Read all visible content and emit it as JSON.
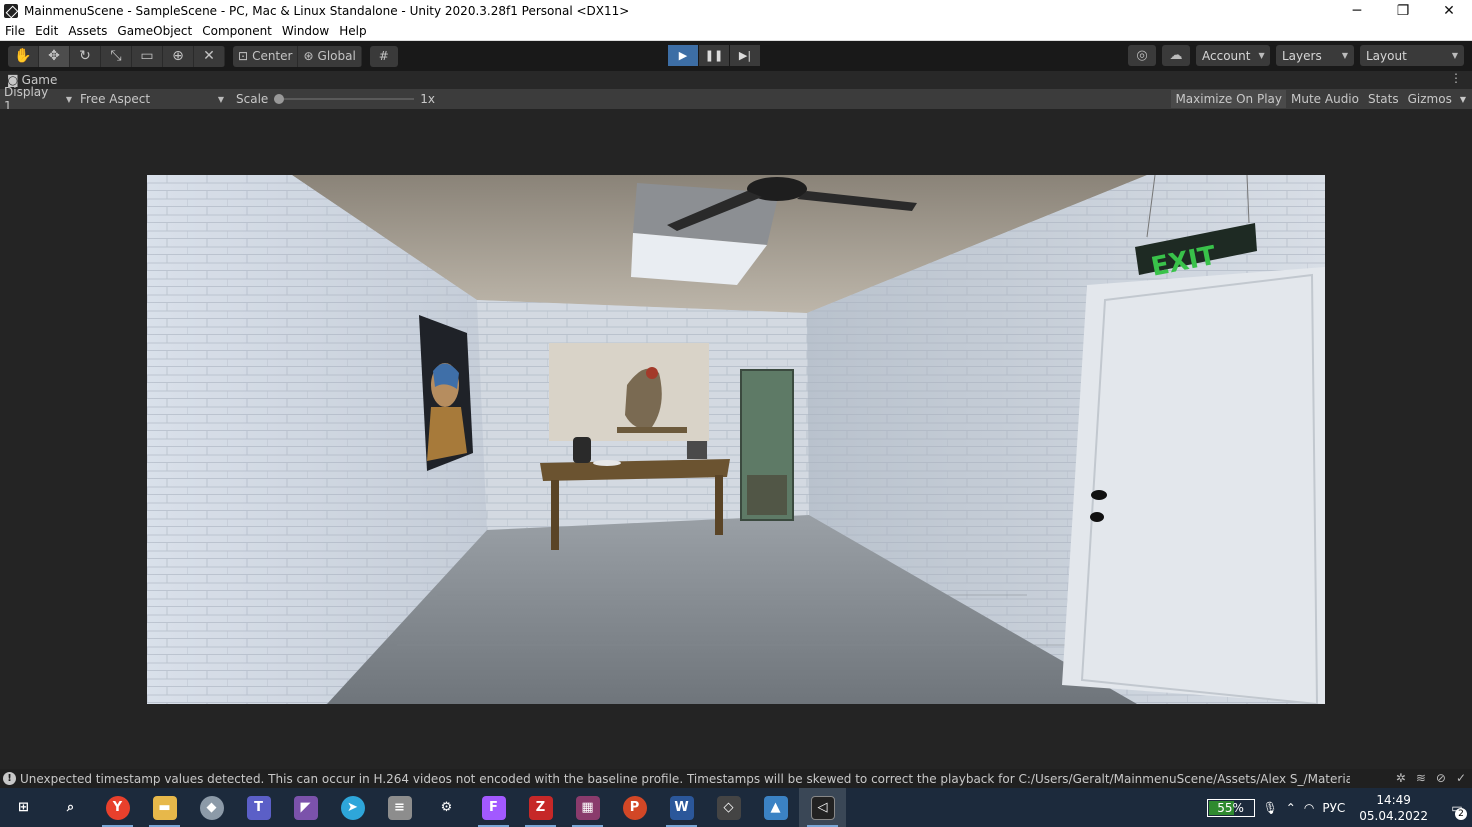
{
  "window": {
    "title": "MainmenuScene - SampleScene - PC, Mac & Linux Standalone - Unity 2020.3.28f1 Personal <DX11>",
    "minimize": "─",
    "restore": "❐",
    "close": "✕"
  },
  "menu": [
    "File",
    "Edit",
    "Assets",
    "GameObject",
    "Component",
    "Window",
    "Help"
  ],
  "toolbar": {
    "tools": [
      "hand-tool-icon",
      "move-tool-icon",
      "rotate-tool-icon",
      "scale-tool-icon",
      "rect-tool-icon",
      "transform-tool-icon",
      "custom-tool-icon"
    ],
    "pivot_center": "Center",
    "pivot_global": "Global",
    "account": "Account",
    "layers": "Layers",
    "layout": "Layout"
  },
  "game_tab": {
    "label": "Game"
  },
  "game_controls": {
    "display": "Display 1",
    "aspect": "Free Aspect",
    "scale_label": "Scale",
    "scale_value": "1x",
    "maximize_on_play": "Maximize On Play",
    "mute_audio": "Mute Audio",
    "stats": "Stats",
    "gizmos": "Gizmos"
  },
  "scene": {
    "exit_sign": "EXIT"
  },
  "status": {
    "message": "Unexpected timestamp values detected. This can occur in H.264 videos not encoded with the baseline profile. Timestamps will be skewed to correct the playback for C:/Users/Geralt/MainmenuScene/Assets/Alex S_/Materials/Cameras/Kam"
  },
  "taskbar": {
    "apps": [
      {
        "name": "start",
        "glyph": "⊞",
        "color": "#1c2a3c"
      },
      {
        "name": "search",
        "glyph": "⌕",
        "color": "#1c2a3c"
      },
      {
        "name": "yandex-browser",
        "glyph": "Y",
        "color": "#e8402c"
      },
      {
        "name": "file-explorer",
        "glyph": "▬",
        "color": "#e7b84a"
      },
      {
        "name": "security",
        "glyph": "◆",
        "color": "#8c9aa8"
      },
      {
        "name": "teams",
        "glyph": "T",
        "color": "#5b5fc7"
      },
      {
        "name": "visual-studio",
        "glyph": "◤",
        "color": "#7b52ab"
      },
      {
        "name": "telegram",
        "glyph": "➤",
        "color": "#2ea6da"
      },
      {
        "name": "database",
        "glyph": "≡",
        "color": "#8d8d8d"
      },
      {
        "name": "settings",
        "glyph": "⚙",
        "color": "#1c2a3c"
      },
      {
        "name": "figma",
        "glyph": "F",
        "color": "#a259ff"
      },
      {
        "name": "filezilla",
        "glyph": "Z",
        "color": "#c62828"
      },
      {
        "name": "winrar",
        "glyph": "▦",
        "color": "#8a3b6c"
      },
      {
        "name": "powerpoint",
        "glyph": "P",
        "color": "#d24726"
      },
      {
        "name": "word",
        "glyph": "W",
        "color": "#2b579a"
      },
      {
        "name": "unity-hub",
        "glyph": "◇",
        "color": "#444"
      },
      {
        "name": "photos",
        "glyph": "▲",
        "color": "#3b82c4"
      },
      {
        "name": "unity",
        "glyph": "◁",
        "color": "#222"
      }
    ],
    "battery": "55%",
    "language": "РУС",
    "time": "14:49",
    "date": "05.04.2022",
    "notifications": "2"
  }
}
